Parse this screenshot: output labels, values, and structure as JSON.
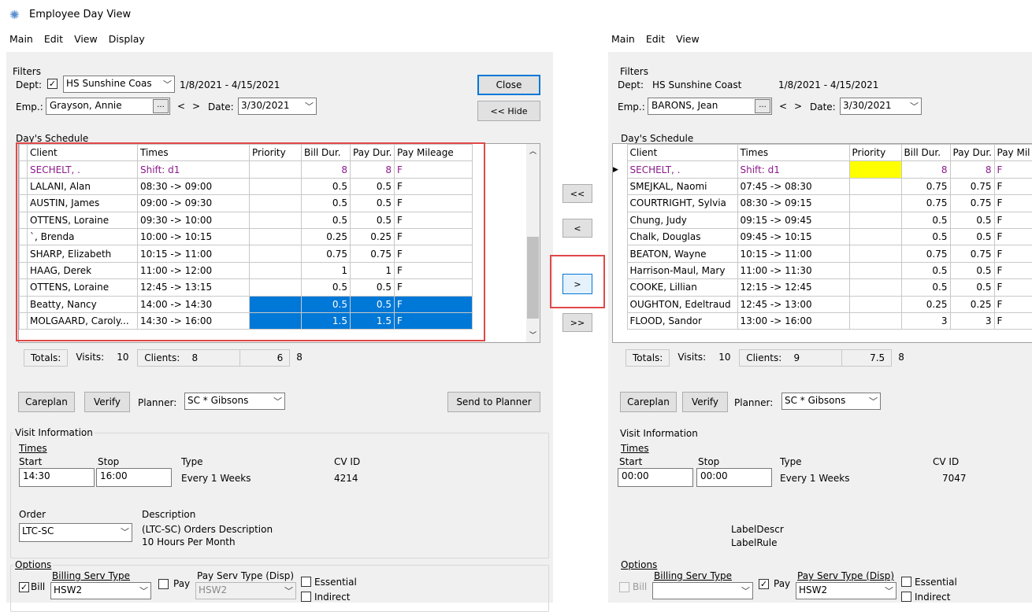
{
  "window": {
    "title": "Employee Day View"
  },
  "left": {
    "menu": [
      "Main",
      "Edit",
      "View",
      "Display"
    ],
    "filters": {
      "label": "Filters",
      "dept_label": "Dept:",
      "dept_checked": true,
      "dept_value": "HS Sunshine Coas",
      "range": "1/8/2021 - 4/15/2021",
      "emp_label": "Emp.:",
      "emp_value": "Grayson, Annie",
      "date_label": "Date:",
      "date_value": "3/30/2021",
      "prev": "<",
      "next": ">",
      "ellipsis": "..."
    },
    "close_label": "Close",
    "hide_label": "<< Hide",
    "schedule_label": "Day's Schedule",
    "columns": [
      "Client",
      "Times",
      "Priority",
      "Bill Dur.",
      "Pay Dur.",
      "Pay Mileage"
    ],
    "rows": [
      {
        "client": "SECHELT, .",
        "times": "Shift: d1",
        "priority": "",
        "bill": "8",
        "pay": "8",
        "mileage": "F"
      },
      {
        "client": "LALANI, Alan",
        "times": "08:30 -> 09:00",
        "priority": "",
        "bill": "0.5",
        "pay": "0.5",
        "mileage": "F"
      },
      {
        "client": "AUSTIN, James",
        "times": "09:00 -> 09:30",
        "priority": "",
        "bill": "0.5",
        "pay": "0.5",
        "mileage": "F"
      },
      {
        "client": "OTTENS, Loraine",
        "times": "09:30 -> 10:00",
        "priority": "",
        "bill": "0.5",
        "pay": "0.5",
        "mileage": "F"
      },
      {
        "client": "`, Brenda",
        "times": "10:00 -> 10:15",
        "priority": "",
        "bill": "0.25",
        "pay": "0.25",
        "mileage": "F"
      },
      {
        "client": "SHARP, Elizabeth",
        "times": "10:15 -> 11:00",
        "priority": "",
        "bill": "0.75",
        "pay": "0.75",
        "mileage": "F"
      },
      {
        "client": "HAAG, Derek",
        "times": "11:00 -> 12:00",
        "priority": "",
        "bill": "1",
        "pay": "1",
        "mileage": "F"
      },
      {
        "client": "OTTENS, Loraine",
        "times": "12:45 -> 13:15",
        "priority": "",
        "bill": "0.5",
        "pay": "0.5",
        "mileage": "F"
      },
      {
        "client": "Beatty, Nancy",
        "times": "14:00 -> 14:30",
        "priority": "",
        "bill": "0.5",
        "pay": "0.5",
        "mileage": "F"
      },
      {
        "client": "MOLGAARD, Caroly...",
        "times": "14:30 -> 16:00",
        "priority": "",
        "bill": "1.5",
        "pay": "1.5",
        "mileage": "F"
      }
    ],
    "totals": {
      "label": "Totals:",
      "visits_label": "Visits:",
      "visits": "10",
      "clients_label": "Clients:",
      "clients": "8",
      "bill": "6",
      "pay": "8"
    },
    "careplan": "Careplan",
    "verify": "Verify",
    "planner_label": "Planner:",
    "planner_value": "SC * Gibsons",
    "send": "Send to Planner",
    "visit": {
      "label": "Visit Information",
      "times_label": "Times",
      "start_label": "Start",
      "stop_label": "Stop",
      "start": "14:30",
      "stop": "16:00",
      "type_label": "Type",
      "type": "Every 1 Weeks",
      "cvid_label": "CV ID",
      "cvid": "4214",
      "order_label": "Order",
      "order": "LTC-SC",
      "desc_label": "Description",
      "desc1": "(LTC-SC) Orders Description",
      "desc2": "10 Hours Per Month"
    },
    "options": {
      "label": "Options",
      "bill": "Bill",
      "billing_serv": "Billing Serv Type",
      "billing_value": "HSW2",
      "pay": "Pay",
      "pay_serv": "Pay Serv Type (Disp)",
      "pay_value": "HSW2",
      "essential": "Essential",
      "indirect": "Indirect"
    }
  },
  "transfer": {
    "all_left": "<<",
    "left": "<",
    "right": ">",
    "all_right": ">>"
  },
  "right": {
    "menu": [
      "Main",
      "Edit",
      "View"
    ],
    "filters": {
      "label": "Filters",
      "dept_label": "Dept:",
      "dept_value": "HS Sunshine Coast",
      "range": "1/8/2021 - 4/15/2021",
      "emp_label": "Emp.:",
      "emp_value": "BARONS, Jean",
      "date_label": "Date:",
      "date_value": "3/30/2021",
      "prev": "<",
      "next": ">",
      "ellipsis": "..."
    },
    "schedule_label": "Day's Schedule",
    "columns": [
      "Client",
      "Times",
      "Priority",
      "Bill Dur.",
      "Pay Dur.",
      "Pay Mil"
    ],
    "rows": [
      {
        "client": "SECHELT, .",
        "times": "Shift: d1",
        "priority": "",
        "bill": "8",
        "pay": "8",
        "mileage": "F"
      },
      {
        "client": "SMEJKAL, Naomi",
        "times": "07:45 -> 08:30",
        "priority": "",
        "bill": "0.75",
        "pay": "0.75",
        "mileage": "F"
      },
      {
        "client": "COURTRIGHT, Sylvia",
        "times": "08:30 -> 09:15",
        "priority": "",
        "bill": "0.75",
        "pay": "0.75",
        "mileage": "F"
      },
      {
        "client": "Chung, Judy",
        "times": "09:15 -> 09:45",
        "priority": "",
        "bill": "0.5",
        "pay": "0.5",
        "mileage": "F"
      },
      {
        "client": "Chalk, Douglas",
        "times": "09:45 -> 10:15",
        "priority": "",
        "bill": "0.5",
        "pay": "0.5",
        "mileage": "F"
      },
      {
        "client": "BEATON, Wayne",
        "times": "10:15 -> 11:00",
        "priority": "",
        "bill": "0.75",
        "pay": "0.75",
        "mileage": "F"
      },
      {
        "client": "Harrison-Maul, Mary",
        "times": "11:00 -> 11:30",
        "priority": "",
        "bill": "0.5",
        "pay": "0.5",
        "mileage": "F"
      },
      {
        "client": "COOKE, Lillian",
        "times": "12:15 -> 12:45",
        "priority": "",
        "bill": "0.5",
        "pay": "0.5",
        "mileage": "F"
      },
      {
        "client": "OUGHTON, Edeltraud",
        "times": "12:45 -> 13:00",
        "priority": "",
        "bill": "0.25",
        "pay": "0.25",
        "mileage": "F"
      },
      {
        "client": "FLOOD, Sandor",
        "times": "13:00 -> 16:00",
        "priority": "",
        "bill": "3",
        "pay": "3",
        "mileage": "F"
      }
    ],
    "totals": {
      "label": "Totals:",
      "visits_label": "Visits:",
      "visits": "10",
      "clients_label": "Clients:",
      "clients": "9",
      "bill": "7.5",
      "pay": "8"
    },
    "careplan": "Careplan",
    "verify": "Verify",
    "planner_label": "Planner:",
    "planner_value": "SC * Gibsons",
    "visit": {
      "label": "Visit Information",
      "times_label": "Times",
      "start_label": "Start",
      "stop_label": "Stop",
      "start": "00:00",
      "stop": "00:00",
      "type_label": "Type",
      "type": "Every 1 Weeks",
      "cvid_label": "CV ID",
      "cvid": "7047",
      "label_descr": "LabelDescr",
      "label_rule": "LabelRule"
    },
    "options": {
      "label": "Options",
      "bill": "Bill",
      "billing_serv": "Billing Serv Type",
      "billing_value": "",
      "pay": "Pay",
      "pay_serv": "Pay Serv Type (Disp)",
      "pay_value": "HSW2",
      "essential": "Essential",
      "indirect": "Indirect"
    }
  },
  "colors": {
    "selection": "#0078d7",
    "highlight_box": "#e04848",
    "shift_row_text": "#8b1a8b",
    "priority_highlight": "#ffff00"
  }
}
